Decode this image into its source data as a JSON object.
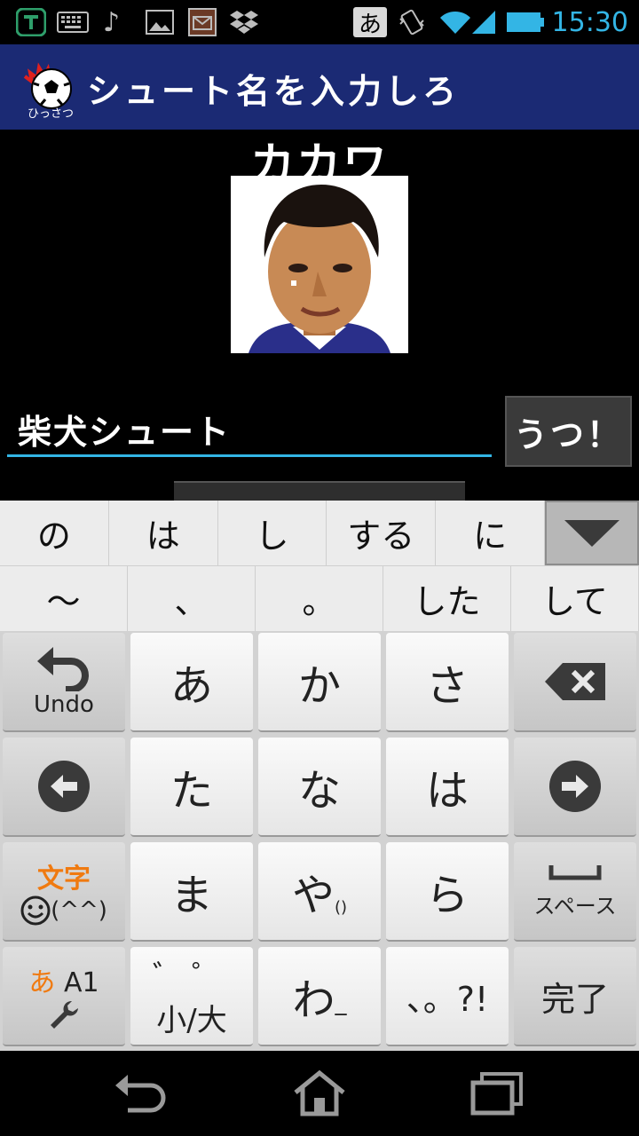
{
  "status_bar": {
    "ime_label": "あ",
    "time": "15:30",
    "icons": [
      "shield-icon",
      "keyboard-icon",
      "music-icon",
      "image-icon",
      "email-icon",
      "dropbox-icon",
      "vibrate-icon",
      "wifi-icon",
      "signal-icon",
      "battery-icon"
    ]
  },
  "app_bar": {
    "logo_caption": "ひっさつ",
    "title": "シュート名を入力しろ"
  },
  "player": {
    "name": "カカワ"
  },
  "shot_input": {
    "value": "柴犬シュート"
  },
  "shoot_button": {
    "label": "うつ！"
  },
  "keyboard": {
    "candidates_row1": [
      "の",
      "は",
      "し",
      "する",
      "に"
    ],
    "candidates_row2": [
      "～",
      "、",
      "。",
      "した",
      "して"
    ],
    "undo_label": "Undo",
    "keys": {
      "a": "あ",
      "ka": "か",
      "sa": "さ",
      "ta": "た",
      "na": "な",
      "ha": "は",
      "ma": "ま",
      "ya": "や",
      "ya_sub": "()",
      "ra": "ら",
      "wa": "わ",
      "wa_sub": "_",
      "punct": "、。?!",
      "dakuten_top": "゛゜",
      "dakuten_bottom": "小/大"
    },
    "moji_label": "文字",
    "emoticon_label": "(^^)",
    "mode_a": "あ",
    "mode_rest": "A1",
    "space_label": "スペース",
    "done_label": "完了"
  },
  "colors": {
    "app_bar": "#1b2a74",
    "accent": "#33b5e5",
    "orange": "#f07a10"
  }
}
